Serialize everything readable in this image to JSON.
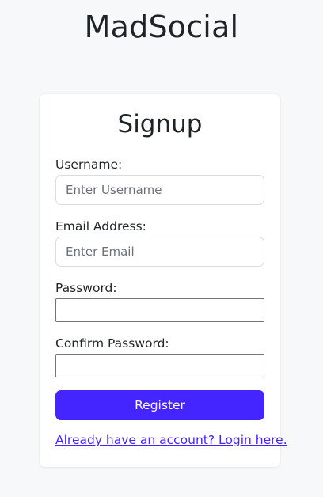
{
  "app": {
    "title": "MadSocial"
  },
  "signup": {
    "title": "Signup",
    "username": {
      "label": "Username:",
      "placeholder": "Enter Username",
      "value": ""
    },
    "email": {
      "label": "Email Address:",
      "placeholder": "Enter Email",
      "value": ""
    },
    "password": {
      "label": "Password:",
      "value": ""
    },
    "confirm_password": {
      "label": "Confirm Password:",
      "value": ""
    },
    "register_label": "Register",
    "login_link": "Already have an account? Login here."
  },
  "colors": {
    "background": "#f6f8fa",
    "accent": "#4424ff",
    "card": "#ffffff"
  }
}
